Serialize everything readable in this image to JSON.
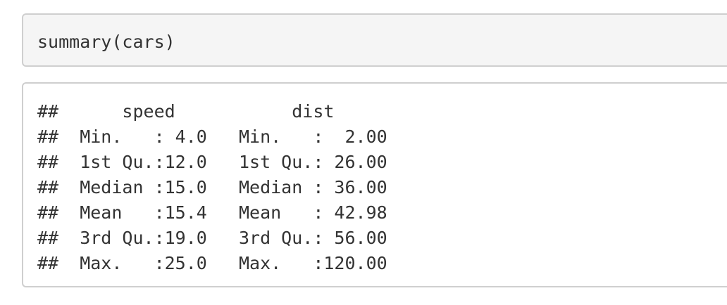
{
  "code": {
    "text": "summary(cars)"
  },
  "output": {
    "lines": [
      "##      speed           dist       ",
      "##  Min.   : 4.0   Min.   :  2.00  ",
      "##  1st Qu.:12.0   1st Qu.: 26.00  ",
      "##  Median :15.0   Median : 36.00  ",
      "##  Mean   :15.4   Mean   : 42.98  ",
      "##  3rd Qu.:19.0   3rd Qu.: 56.00  ",
      "##  Max.   :25.0   Max.   :120.00  "
    ]
  }
}
